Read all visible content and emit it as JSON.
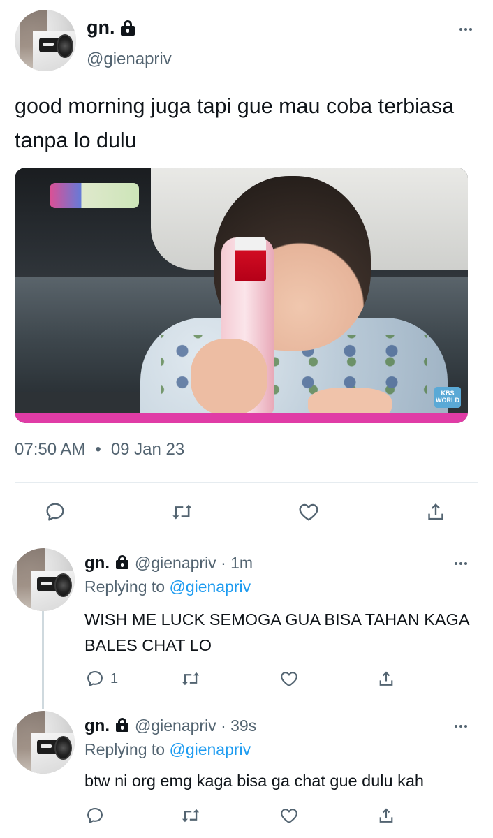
{
  "main_tweet": {
    "name": "gn.",
    "handle": "@gienapriv",
    "text": "good morning juga tapi gue mau coba terbiasa tanpa lo dulu",
    "time": "07:50 AM",
    "separator": "•",
    "date": "09 Jan 23",
    "media": {
      "watermark_br": "KBS WORLD"
    },
    "icons": {
      "lock": "lock-icon",
      "more": "more-icon",
      "reply": "reply-icon",
      "retweet": "retweet-icon",
      "like": "heart-icon",
      "share": "share-icon"
    }
  },
  "replies": [
    {
      "name": "gn.",
      "handle": "@gienapriv",
      "time": "· 1m",
      "replying_label": "Replying to",
      "replying_to": "@gienapriv",
      "text": "WISH ME LUCK SEMOGA GUA BISA TAHAN KAGA BALES CHAT LO",
      "reply_count": "1"
    },
    {
      "name": "gn.",
      "handle": "@gienapriv",
      "time": "· 39s",
      "replying_label": "Replying to",
      "replying_to": "@gienapriv",
      "text": "btw ni org emg kaga bisa ga chat gue dulu kah",
      "reply_count": ""
    }
  ],
  "colors": {
    "text": "#0f1419",
    "secondary": "#536471",
    "link": "#1d9bf0",
    "divider": "#e6ecf0"
  }
}
